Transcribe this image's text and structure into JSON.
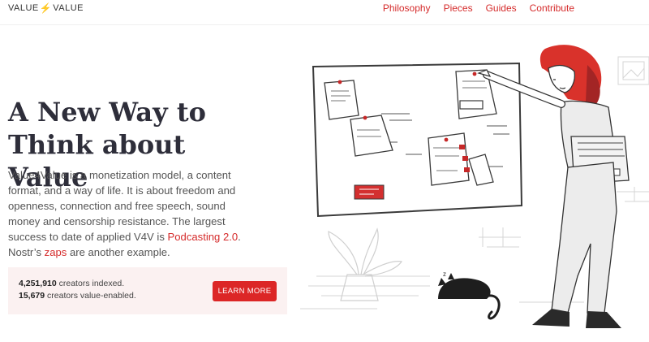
{
  "header": {
    "logo_left": "VALUE",
    "logo_bolt": "4",
    "logo_right": "VALUE",
    "nav": [
      "Philosophy",
      "Pieces",
      "Guides",
      "Contribute"
    ]
  },
  "hero": {
    "title_line1": "A New Way to",
    "title_line2": "Think about Value",
    "intro_part1": "Value4Value is a monetization model, a content format, and a way of life. It is about freedom and openness, connection and free speech, sound money and censorship resistance. The largest success to date of applied V4V is ",
    "intro_link1": "Podcasting 2.0",
    "intro_part2": ". Nostr’s ",
    "intro_link2": "zaps",
    "intro_part3": " are another example."
  },
  "stats": {
    "indexed_count": "4,251,910",
    "indexed_label": " creators indexed.",
    "enabled_count": "15,679",
    "enabled_label": " creators value-enabled.",
    "button_label": "LEARN MORE"
  },
  "colors": {
    "accent": "#dc2626",
    "title": "#2e2e3a",
    "box": "#fbf1f1"
  },
  "icons": [
    "lightning-bolt-icon"
  ]
}
